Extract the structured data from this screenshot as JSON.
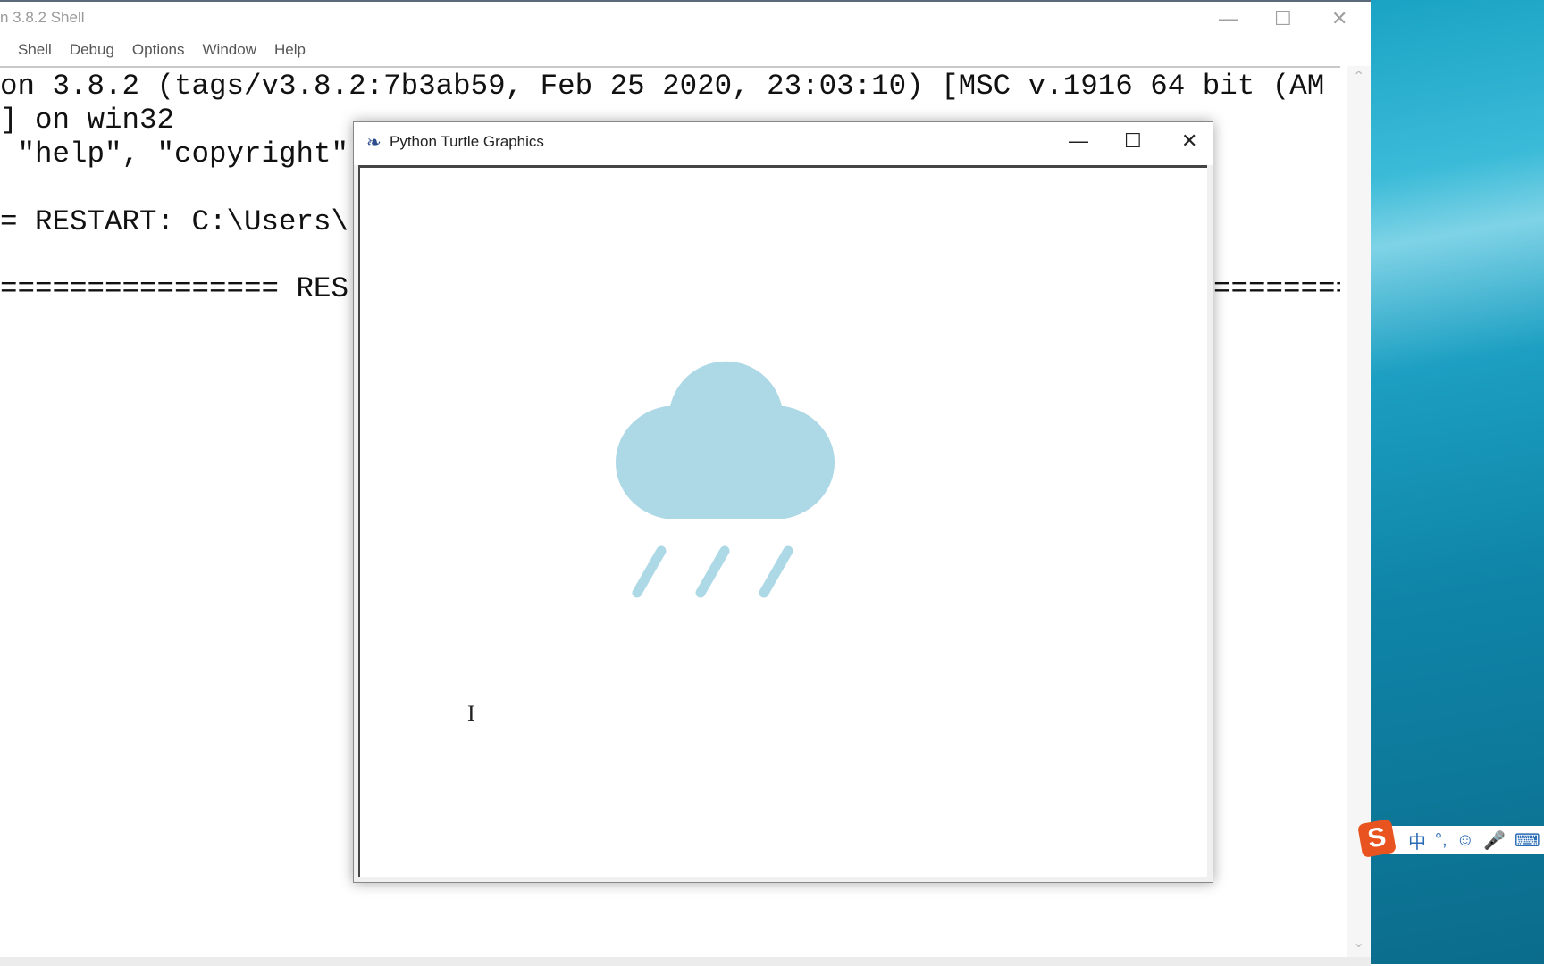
{
  "idle": {
    "title": "n 3.8.2 Shell",
    "menu": [
      "Shell",
      "Debug",
      "Options",
      "Window",
      "Help"
    ],
    "lines": [
      "on 3.8.2 (tags/v3.8.2:7b3ab59, Feb 25 2020, 23:03:10) [MSC v.1916 64 bit (AM",
      "] on win32",
      " \"help\", \"copyright\"",
      "",
      "= RESTART: C:\\Users\\",
      "",
      "================ RES"
    ],
    "trailing_equals": "========="
  },
  "turtle": {
    "title": "Python Turtle Graphics",
    "drawing_color": "#add8e6"
  },
  "ime": {
    "logo": "S",
    "items": [
      "中",
      "°,",
      "☺",
      "🎤",
      "⌨"
    ]
  }
}
